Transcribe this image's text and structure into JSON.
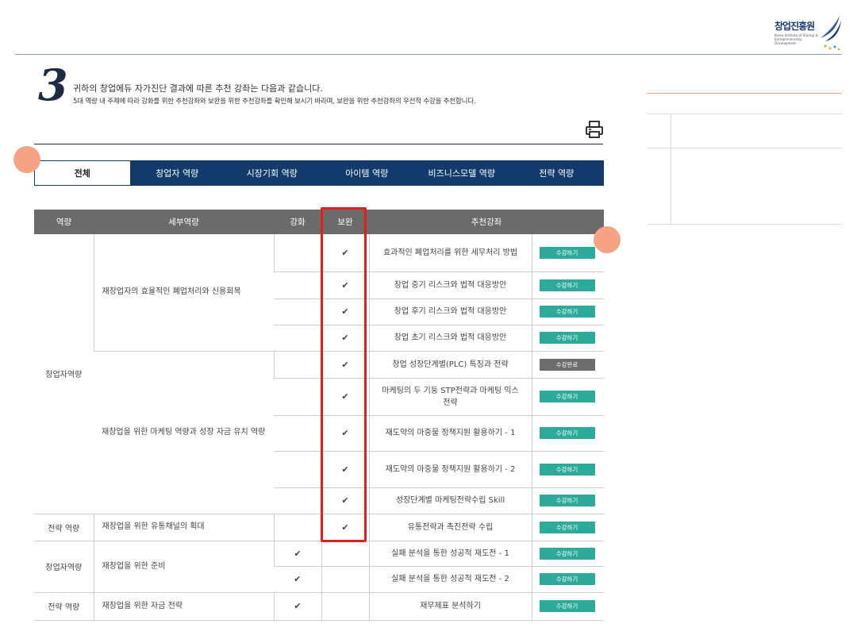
{
  "logo": {
    "name": "창업진흥원",
    "subtitle": "Korea Institute of Startup & Entrepreneurship Development"
  },
  "heading": {
    "step_number": "3",
    "main_text": "귀하의 창업에듀 자가진단 결과에 따른 추천 강좌는 다음과 같습니다.",
    "sub_text": "5대 역량 내 주제에 따라 강화를 위한 추천강좌와 보완을 위한 추천강좌를 확인해 보시기 바라며, 보완을 위한 추천강좌의 우선적 수강을 추천합니다."
  },
  "icons": {
    "print": "print-icon"
  },
  "tabs": [
    {
      "label": "전체",
      "active": true
    },
    {
      "label": "창업자 역량"
    },
    {
      "label": "시장기회 역량"
    },
    {
      "label": "아이템 역량"
    },
    {
      "label": "비즈니스모델 역량"
    },
    {
      "label": "전략 역량"
    }
  ],
  "table": {
    "headers": {
      "competency": "역량",
      "detail": "세부역량",
      "strengthen": "강화",
      "supplement": "보완",
      "course": "추천강좌"
    },
    "groups": [
      {
        "competency": "창업자역량",
        "details": [
          {
            "label": "재창업자의 효율적인 폐업처리와 신용회복"
          },
          {
            "label": "재창업을 위한 마케팅 역량과 성장 자금 유치 역량"
          }
        ]
      },
      {
        "competency": "전략 역량",
        "detail": "재창업을 위한 유통채널의 획대"
      },
      {
        "competency": "창업자역량",
        "detail": "재창업을 위한 준비"
      },
      {
        "competency": "전략 역량",
        "detail": "재창업을 위한 자금 전략"
      }
    ],
    "rows": [
      {
        "course": "효과적인 폐업처리를 위한 세무처리 방법",
        "strengthen": "",
        "supplement": "✔",
        "button": "수강하기",
        "done": false
      },
      {
        "course": "창업 중기 리스크와 법적 대응방안",
        "strengthen": "",
        "supplement": "✔",
        "button": "수강하기",
        "done": false
      },
      {
        "course": "창업 후기 리스크와 법적 대응방안",
        "strengthen": "",
        "supplement": "✔",
        "button": "수강하기",
        "done": false
      },
      {
        "course": "창업 초기 리스크와 법적 대응방안",
        "strengthen": "",
        "supplement": "✔",
        "button": "수강하기",
        "done": false
      },
      {
        "course": "창업 성장단계별(PLC) 특징과 전략",
        "strengthen": "",
        "supplement": "✔",
        "button": "수강완료",
        "done": true
      },
      {
        "course": "마케팅의 두 기둥 STP전략과 마케팅 믹스전략",
        "strengthen": "",
        "supplement": "✔",
        "button": "수강하기",
        "done": false
      },
      {
        "course": "재도약의 마중물 정책지원 활용하기 - 1",
        "strengthen": "",
        "supplement": "✔",
        "button": "수강하기",
        "done": false
      },
      {
        "course": "재도약의 마중물 정책지원 활용하기 - 2",
        "strengthen": "",
        "supplement": "✔",
        "button": "수강하기",
        "done": false
      },
      {
        "course": "성장단계별 마케팅전략수립 Skill",
        "strengthen": "",
        "supplement": "✔",
        "button": "수강하기",
        "done": false
      },
      {
        "course": "유통전략과 촉진전략 수립",
        "strengthen": "",
        "supplement": "✔",
        "button": "수강하기",
        "done": false
      },
      {
        "course": "실패 분석을 통한 성공적 재도전 - 1",
        "strengthen": "✔",
        "supplement": "",
        "button": "수강하기",
        "done": false
      },
      {
        "course": "실패 분석을 통한 성공적 재도전 - 2",
        "strengthen": "✔",
        "supplement": "",
        "button": "수강하기",
        "done": false
      },
      {
        "course": "재무제표 분석하기",
        "strengthen": "✔",
        "supplement": "",
        "button": "수강하기",
        "done": false
      }
    ]
  },
  "colors": {
    "navy": "#123a6b",
    "teal_button": "#2eaa9b",
    "done_button": "#6c6c6c",
    "highlight": "#e02020",
    "dot": "#f6a384"
  }
}
